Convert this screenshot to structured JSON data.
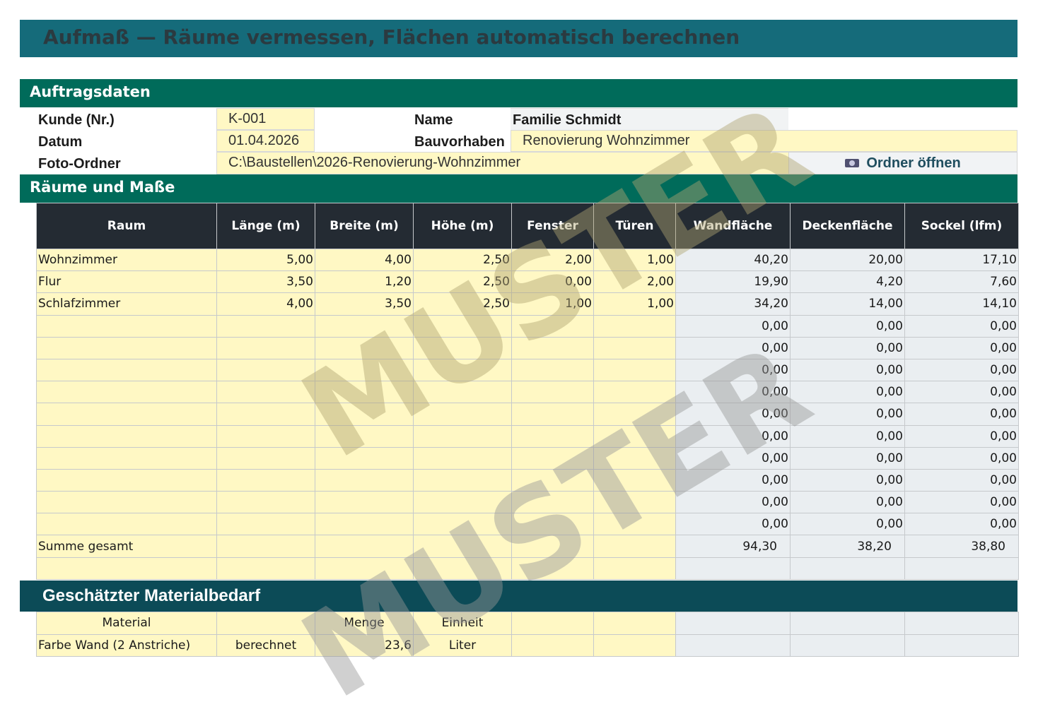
{
  "title": "Aufmaß  —  Räume vermessen, Flächen automatisch berechnen",
  "section_order": "Auftragsdaten",
  "section_rooms": "Räume und Maße",
  "section_material": "Geschätzter Materialbedarf",
  "order": {
    "kunde_label": "Kunde (Nr.)",
    "kunde_value": "K-001",
    "datum_label": "Datum",
    "datum_value": "01.04.2026",
    "foto_label": "Foto-Ordner",
    "foto_value": "C:\\Baustellen\\2026-Renovierung-Wohnzimmer",
    "name_label": "Name",
    "name_value": "Familie Schmidt",
    "bau_label": "Bauvorhaben",
    "bau_value": "Renovierung Wohnzimmer",
    "open_folder_button": "Ordner öffnen"
  },
  "table": {
    "headers": [
      "Raum",
      "Länge (m)",
      "Breite (m)",
      "Höhe (m)",
      "Fenster",
      "Türen",
      "Wandfläche",
      "Deckenfläche",
      "Sockel (lfm)"
    ],
    "rows": [
      [
        "Wohnzimmer",
        "5,00",
        "4,00",
        "2,50",
        "2,00",
        "1,00",
        "40,20",
        "20,00",
        "17,10"
      ],
      [
        "Flur",
        "3,50",
        "1,20",
        "2,50",
        "0,00",
        "2,00",
        "19,90",
        "4,20",
        "7,60"
      ],
      [
        "Schlafzimmer",
        "4,00",
        "3,50",
        "2,50",
        "1,00",
        "1,00",
        "34,20",
        "14,00",
        "14,10"
      ],
      [
        "",
        "",
        "",
        "",
        "",
        "",
        "0,00",
        "0,00",
        "0,00"
      ],
      [
        "",
        "",
        "",
        "",
        "",
        "",
        "0,00",
        "0,00",
        "0,00"
      ],
      [
        "",
        "",
        "",
        "",
        "",
        "",
        "0,00",
        "0,00",
        "0,00"
      ],
      [
        "",
        "",
        "",
        "",
        "",
        "",
        "0,00",
        "0,00",
        "0,00"
      ],
      [
        "",
        "",
        "",
        "",
        "",
        "",
        "0,00",
        "0,00",
        "0,00"
      ],
      [
        "",
        "",
        "",
        "",
        "",
        "",
        "0,00",
        "0,00",
        "0,00"
      ],
      [
        "",
        "",
        "",
        "",
        "",
        "",
        "0,00",
        "0,00",
        "0,00"
      ],
      [
        "",
        "",
        "",
        "",
        "",
        "",
        "0,00",
        "0,00",
        "0,00"
      ],
      [
        "",
        "",
        "",
        "",
        "",
        "",
        "0,00",
        "0,00",
        "0,00"
      ],
      [
        "",
        "",
        "",
        "",
        "",
        "",
        "0,00",
        "0,00",
        "0,00"
      ]
    ],
    "sum_label": "Summe gesamt",
    "sum_values": [
      "94,30",
      "38,20",
      "38,80"
    ]
  },
  "material": {
    "headers": [
      "Material",
      "",
      "Menge",
      "Einheit"
    ],
    "rows": [
      [
        "Farbe Wand (2 Anstriche)",
        "berechnet",
        "23,6",
        "Liter"
      ]
    ]
  },
  "watermark": "MUSTER",
  "icons": {
    "open_folder": "camera-icon"
  }
}
